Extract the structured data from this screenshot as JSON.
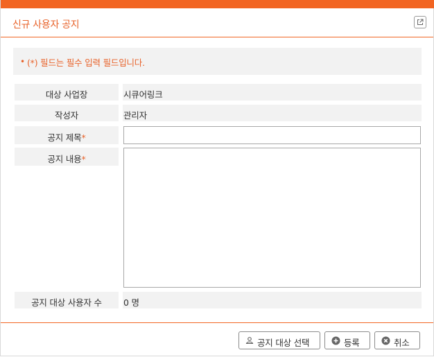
{
  "dialog": {
    "title": "신규 사용자 공지",
    "popout_icon": "external-link-icon"
  },
  "notice": {
    "bullet": "•",
    "text": "(*) 필드는 필수 입력 필드입니다."
  },
  "form": {
    "workplace": {
      "label": "대상 사업장",
      "value": "시큐어링크"
    },
    "author": {
      "label": "작성자",
      "value": "관리자"
    },
    "notice_title": {
      "label": "공지 제목",
      "required_mark": "*",
      "value": ""
    },
    "notice_content": {
      "label": "공지 내용",
      "required_mark": "*",
      "value": ""
    },
    "target_count": {
      "label": "공지 대상 사용자 수",
      "value": "0 명"
    }
  },
  "buttons": {
    "select_target": {
      "label": "공지 대상 선택",
      "icon": "user-icon"
    },
    "register": {
      "label": "등록",
      "icon": "plus-circle-icon"
    },
    "cancel": {
      "label": "취소",
      "icon": "close-circle-icon"
    }
  },
  "colors": {
    "accent": "#f26522",
    "accent_text": "#e8632b",
    "label_bg": "#f2f2f2"
  }
}
